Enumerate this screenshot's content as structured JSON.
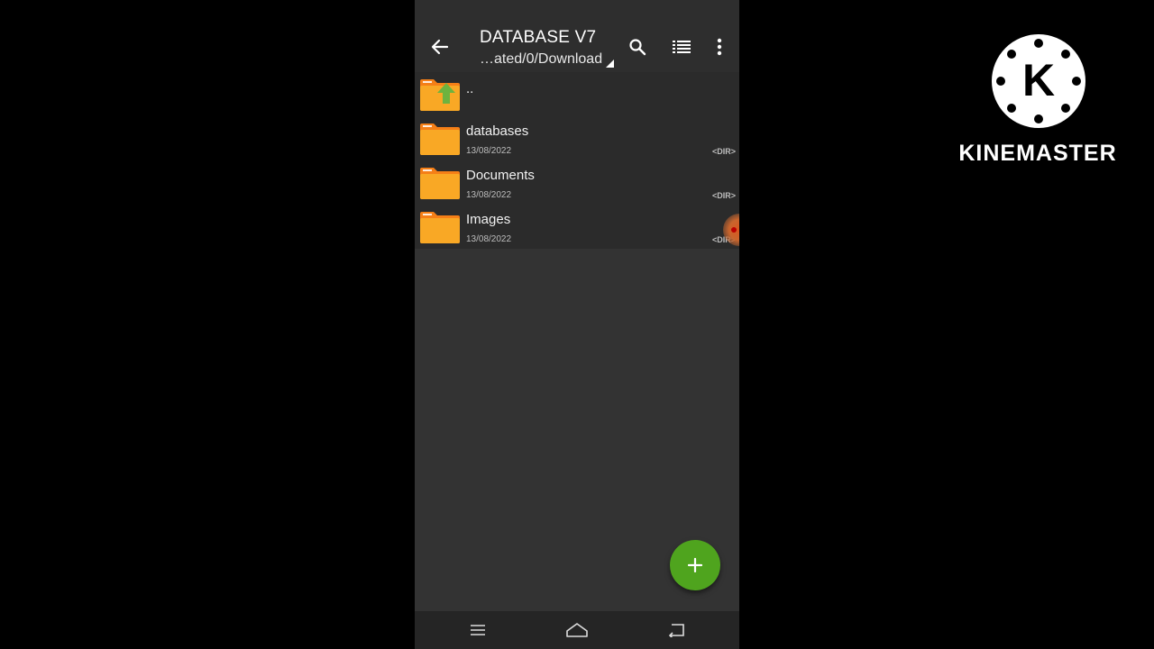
{
  "appbar": {
    "title": "DATABASE V7",
    "path": "…ated/0/Download"
  },
  "files": [
    {
      "name": "..",
      "date": "",
      "type": "",
      "icon": "folder-up-icon"
    },
    {
      "name": "databases",
      "date": "13/08/2022",
      "type": "<DIR>",
      "icon": "folder-icon"
    },
    {
      "name": "Documents",
      "date": "13/08/2022",
      "type": "<DIR>",
      "icon": "folder-icon"
    },
    {
      "name": "Images",
      "date": "13/08/2022",
      "type": "<DIR>",
      "icon": "folder-icon"
    }
  ],
  "fab": {
    "icon": "plus-icon"
  },
  "navbar": {
    "icons": [
      "menu-icon",
      "home-icon",
      "back-icon"
    ]
  },
  "watermark": {
    "text": "KINEMASTER",
    "letter": "K"
  },
  "colors": {
    "folder": "#f9a825",
    "folder_dark": "#f57f17",
    "fab": "#4fa41e",
    "up_arrow": "#6db33f"
  }
}
